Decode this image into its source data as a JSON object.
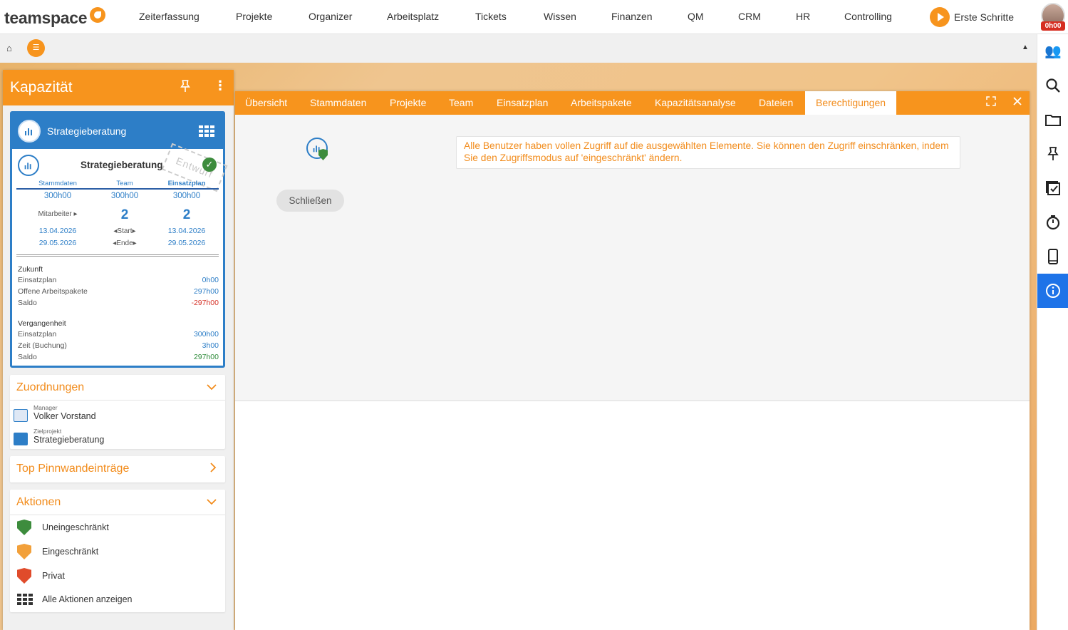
{
  "app": {
    "logo": "teamspace"
  },
  "nav": [
    "Zeiterfassung",
    "Projekte",
    "Organizer",
    "Arbeitsplatz",
    "Tickets",
    "Wissen",
    "Finanzen",
    "QM",
    "CRM",
    "HR",
    "Controlling"
  ],
  "erste_schritte": "Erste Schritte",
  "avatar_time": "0h00",
  "subbar": {
    "home_icon": "home-icon",
    "menu_icon": "menu-icon",
    "collapse_icon": "caret-up-icon"
  },
  "rightbar": {
    "icons": [
      "people-icon",
      "search-icon",
      "folder-icon",
      "pin-icon",
      "checklist-icon",
      "timer-icon",
      "mobile-icon",
      "info-icon"
    ]
  },
  "side": {
    "title": "Kapazität",
    "card_title": "Strategieberatung",
    "project_name": "Strategieberatung",
    "stamp": "Entwurf",
    "columns": [
      "Stammdaten",
      "Team",
      "Einsatzplan"
    ],
    "hours": [
      "300h00",
      "300h00",
      "300h00"
    ],
    "mitarbeiter_label": "Mitarbeiter ▸",
    "mitarbeiter": [
      "2",
      "2"
    ],
    "start_dates": [
      "13.04.2026",
      "13.04.2026"
    ],
    "start_label": "◂Start▸",
    "end_dates": [
      "29.05.2026",
      "29.05.2026"
    ],
    "end_label": "◂Ende▸",
    "zukunft": {
      "title": "Zukunft",
      "rows": [
        {
          "label": "Einsatzplan",
          "value": "0h00"
        },
        {
          "label": "Offene Arbeitspakete",
          "value": "297h00"
        },
        {
          "label": "Saldo",
          "value": "-297h00"
        }
      ]
    },
    "vergangenheit": {
      "title": "Vergangenheit",
      "rows": [
        {
          "label": "Einsatzplan",
          "value": "300h00"
        },
        {
          "label": "Zeit (Buchung)",
          "value": "3h00"
        },
        {
          "label": "Saldo",
          "value": "297h00"
        }
      ]
    },
    "zuordnungen": {
      "title": "Zuordnungen",
      "items": [
        {
          "small": "Manager",
          "main": "Volker Vorstand"
        },
        {
          "small": "Zielprojekt",
          "main": "Strategieberatung"
        }
      ]
    },
    "pinnwand": "Top Pinnwandeinträge",
    "aktionen": {
      "title": "Aktionen",
      "items": [
        "Uneingeschränkt",
        "Eingeschränkt",
        "Privat",
        "Alle Aktionen anzeigen"
      ]
    }
  },
  "tabs": [
    "Übersicht",
    "Stammdaten",
    "Projekte",
    "Team",
    "Einsatzplan",
    "Arbeitspakete",
    "Kapazitätsanalyse",
    "Dateien",
    "Berechtigungen"
  ],
  "active_tab": "Berechtigungen",
  "message": "Alle Benutzer haben vollen Zugriff auf die ausgewählten Elemente. Sie können den Zugriff einschränken, indem Sie den Zugriffsmodus auf 'eingeschränkt' ändern.",
  "close_button": "Schließen",
  "colors": {
    "accent": "#f7941d",
    "blue": "#2d7ec7",
    "info": "#1e73e8"
  }
}
